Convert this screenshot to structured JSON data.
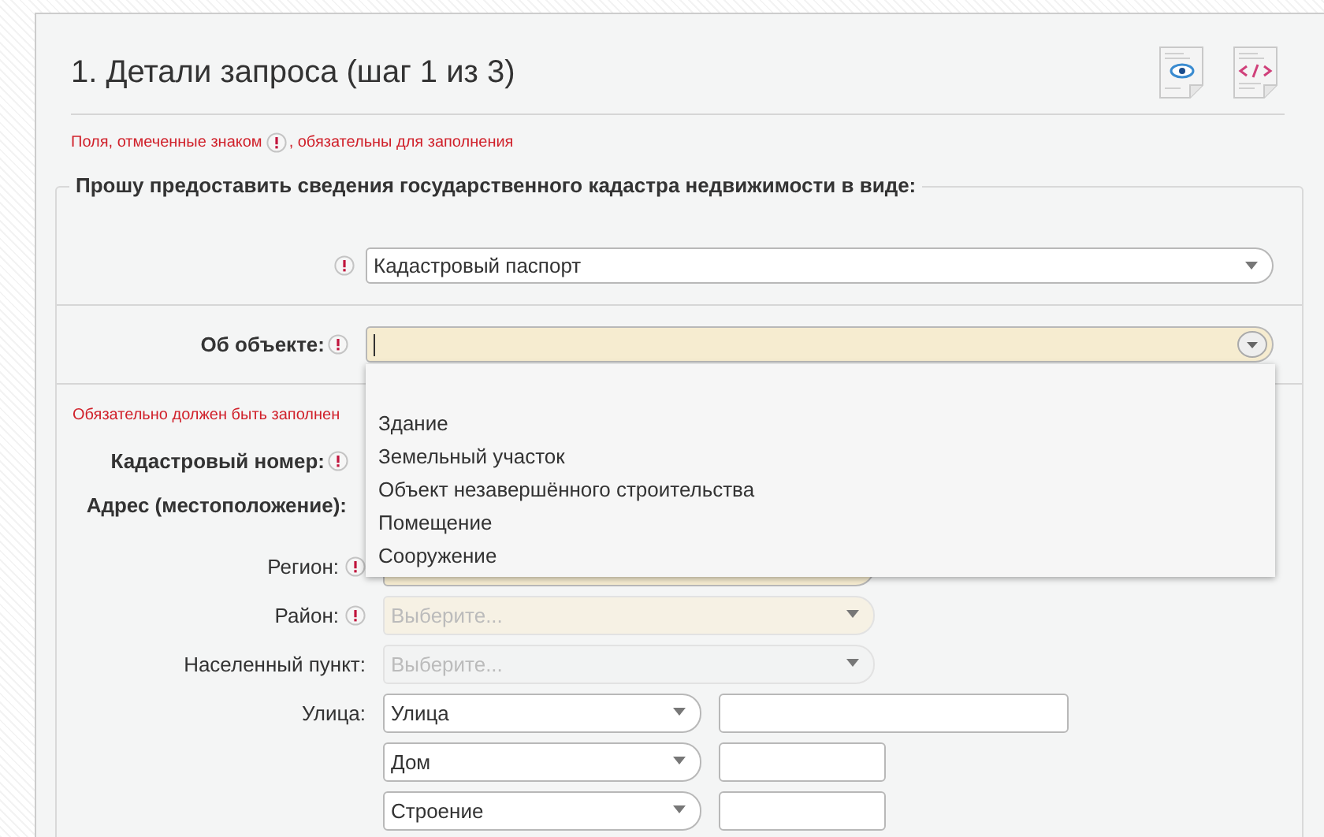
{
  "header": {
    "title": "1. Детали запроса (шаг 1 из 3)",
    "note_before": "Поля, отмеченные знаком",
    "note_after": ", обязательны для заполнения"
  },
  "fieldset": {
    "legend": "Прошу предоставить сведения государственного кадастра недвижимости в виде:"
  },
  "document_type": {
    "value": "Кадастровый паспорт",
    "required": true
  },
  "object": {
    "label": "Об объекте:",
    "required": true,
    "expanded": true,
    "options": [
      "Здание",
      "Земельный участок",
      "Объект незавершённого строительства",
      "Помещение",
      "Сооружение"
    ]
  },
  "validation_message": "Обязательно должен быть заполнен",
  "cadastral_number": {
    "label": "Кадастровый номер:",
    "required": true
  },
  "address": {
    "label": "Адрес (местоположение):",
    "selects": [
      {
        "label": "Регион:",
        "required": true,
        "disabled": false
      },
      {
        "label": "Район:",
        "required": true,
        "disabled": true,
        "placeholder": "Выберите..."
      },
      {
        "label": "Населенный пункт:",
        "required": false,
        "disabled": true,
        "placeholder": "Выберите..."
      }
    ],
    "parts": [
      {
        "label": "Улица:",
        "value": "Улица",
        "kind": "wide"
      },
      {
        "value": "Дом",
        "kind": "short"
      },
      {
        "value": "Строение",
        "kind": "short"
      }
    ]
  }
}
